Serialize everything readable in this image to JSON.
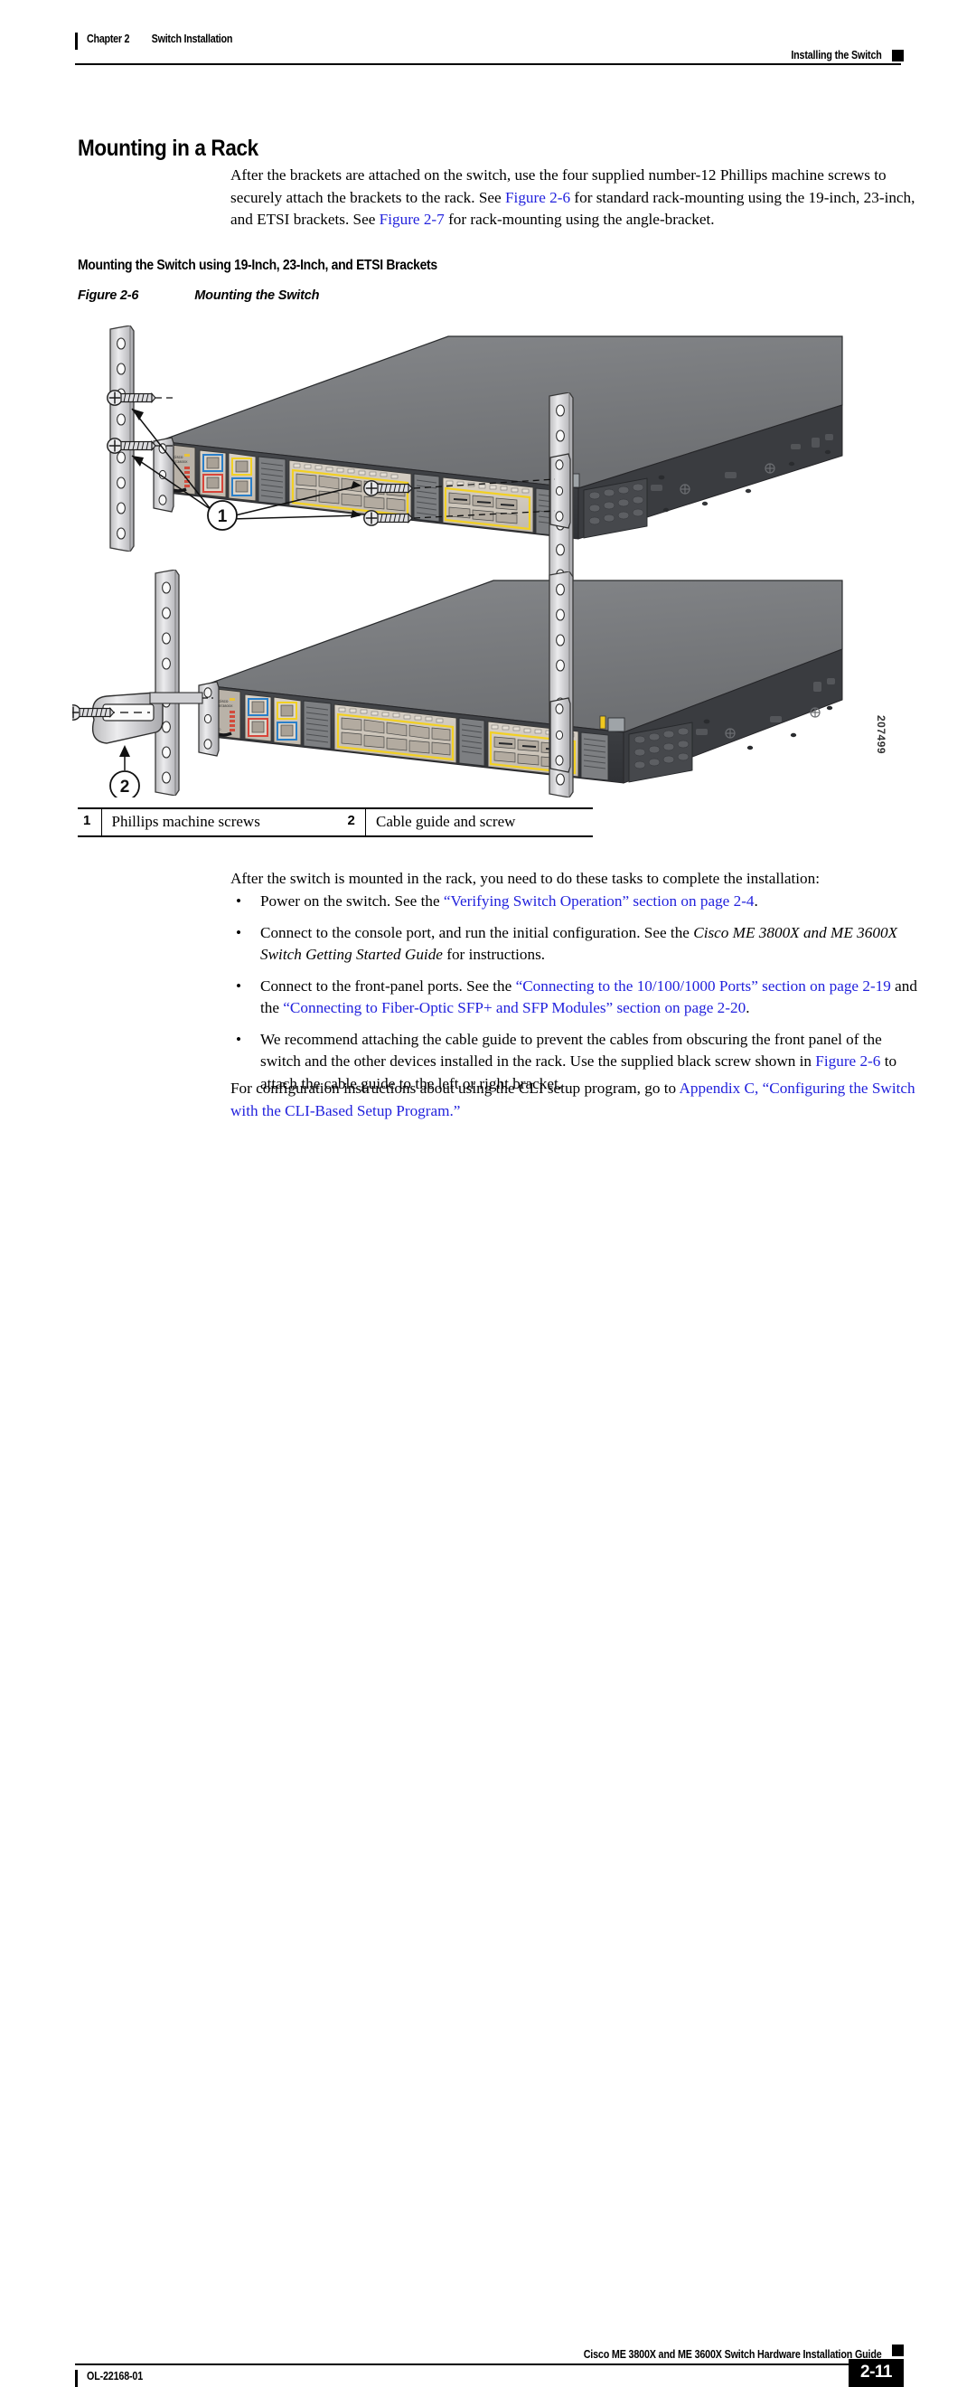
{
  "header": {
    "chapter": "Chapter 2",
    "chapter_title": "Switch Installation",
    "section": "Installing the Switch"
  },
  "main": {
    "title": "Mounting in a Rack",
    "intro_paragraph": "After the brackets are attached on the switch, use the four supplied number-12 Phillips machine screws to securely attach the brackets to the rack. See ",
    "intro_link1": "Figure 2-6",
    "intro_mid": " for standard rack-mounting using the 19-inch, 23-inch, and ETSI brackets. See ",
    "intro_link2": "Figure 2-7",
    "intro_end": " for rack-mounting using the angle-bracket.",
    "subheading": "Mounting the Switch using 19-Inch, 23-Inch, and ETSI Brackets"
  },
  "figure": {
    "label": "Figure 2-6",
    "caption": "Mounting the Switch",
    "art_id": "207499",
    "callouts": [
      {
        "number": "1",
        "label": "Phillips machine screws"
      },
      {
        "number": "2",
        "label": "Cable guide and screw"
      }
    ],
    "device_brand": "cisco",
    "device_model": "ME 3800X"
  },
  "post_figure": {
    "paragraph": "After the switch is mounted in the rack, you need to do these tasks to complete the installation:",
    "bullets": [
      {
        "pre": "Power on the switch. See the ",
        "link": "“Verifying Switch Operation” section on page 2-4",
        "post": "."
      },
      {
        "pre": "Connect to the console port, and run the initial configuration. See the ",
        "italic": "Cisco ME 3800X and ME 3600X Switch Getting Started Guide",
        "post": " for instructions."
      },
      {
        "pre": "Connect to the front-panel ports. See the ",
        "link": "“Connecting to the 10/100/1000 Ports” section on page 2-19",
        "mid": " and the ",
        "link2": "“Connecting to Fiber-Optic SFP+ and SFP Modules” section on page 2-20",
        "post": "."
      },
      {
        "pre": "We recommend attaching the cable guide to prevent the cables from obscuring the front panel of the switch and the other devices installed in the rack. Use the supplied black screw shown in ",
        "link": "Figure 2-6",
        "post": " to attach the cable guide to the left or right bracket."
      }
    ],
    "final_pre": "For configuration instructions about using the CLI setup program, go to ",
    "final_link": "Appendix C, “Configuring the Switch with the CLI-Based Setup Program.”"
  },
  "footer": {
    "guide_title": "Cisco ME 3800X and ME 3600X Switch Hardware Installation Guide",
    "doc_number": "OL-22168-01",
    "page_number": "2-11"
  },
  "colors": {
    "link": "#2222dd",
    "chassis_top": "#76787b",
    "chassis_front": "#3a3c40",
    "module_face": "#cfc7bc",
    "bezel_yellow": "#f2d024",
    "bezel_blue": "#2a7fc9",
    "bezel_red": "#d8453a",
    "rail_metal": "#d8d8da"
  }
}
